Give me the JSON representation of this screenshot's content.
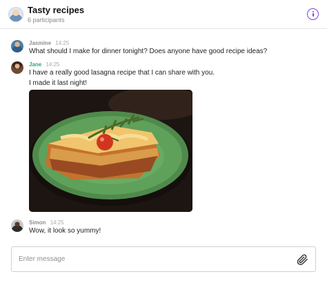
{
  "header": {
    "title": "Tasty recipes",
    "subtitle": "6 participants",
    "info_icon": "info-icon",
    "accent_color": "#7b3fe4"
  },
  "messages": [
    {
      "author": "Jasmine",
      "time": "14:25",
      "lines": [
        "What should I make for dinner tonight? Does anyone have good recipe ideas?"
      ]
    },
    {
      "author": "Jane",
      "time": "14:25",
      "author_color": "#2aa879",
      "lines": [
        "I have a really good lasagna recipe that I can share with you.",
        "I made it last night!"
      ],
      "attachment": "image"
    },
    {
      "author": "Simon",
      "time": "14:25",
      "lines": [
        "Wow, it look so yummy!"
      ]
    }
  ],
  "composer": {
    "placeholder": "Enter message",
    "value": "",
    "attach_icon": "paperclip-icon"
  }
}
